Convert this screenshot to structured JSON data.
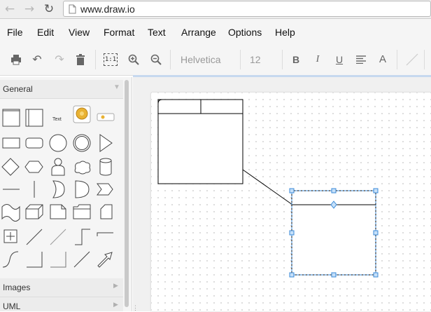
{
  "browser": {
    "back_icon": "arrow-left-icon",
    "forward_icon": "arrow-right-icon",
    "reload_icon": "reload-icon",
    "url": "www.draw.io"
  },
  "menu": [
    "File",
    "Edit",
    "View",
    "Format",
    "Text",
    "Arrange",
    "Options",
    "Help"
  ],
  "toolbar": {
    "icons": [
      "print-icon",
      "undo-icon",
      "redo-icon",
      "delete-icon",
      "actual-size-icon",
      "zoom-in-icon",
      "zoom-out-icon",
      "bold-icon",
      "italic-icon",
      "underline-icon",
      "align-icon",
      "font-color-icon",
      "line-icon"
    ],
    "actual_size": "1:1",
    "font_family": "Helvetica",
    "font_size": "12",
    "bold": "B",
    "italic": "I",
    "underline": "U",
    "font_color": "A"
  },
  "sidebar": {
    "general_title": "General",
    "text_shape_label": "Text",
    "images_title": "Images",
    "uml_title": "UML"
  },
  "colors": {
    "selection": "#3a8ad8",
    "handle_fill": "#c6e0f9",
    "accent_line": "#c6d9ef"
  }
}
